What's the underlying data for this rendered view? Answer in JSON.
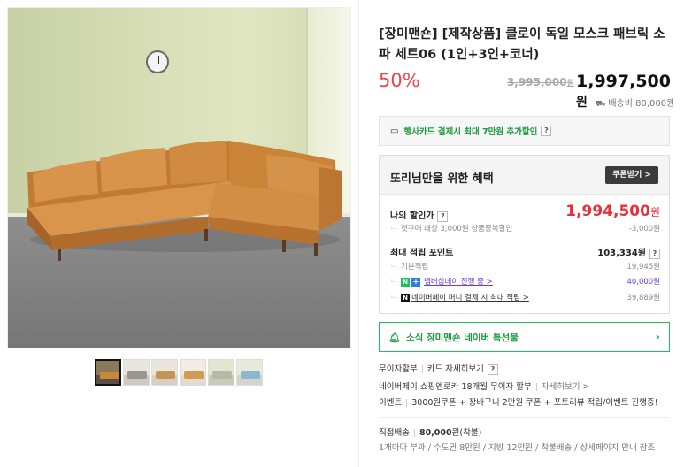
{
  "product": {
    "title": "[장미맨숀] [제작상품] 클로이 독일 모스크 패브릭 소파 세트06 (1인+3인+코너)",
    "discount_rate": "50%",
    "original_price": "3,995,000",
    "original_price_unit": "원",
    "price": "1,997,500",
    "price_unit": "원",
    "shipping": "배송비 80,000원"
  },
  "card_promo": {
    "text": "행사카드 결제시 최대 7만원 추가할인",
    "help": "?"
  },
  "benefit": {
    "title": "또리님만을 위한 혜택",
    "coupon_button": "쿠폰받기 >",
    "my_discount_label": "나의 할인가",
    "my_discount_price": "1,994,500",
    "my_discount_unit": "원",
    "first_purchase_label": "첫구매 대상 3,000원 상품중복할인",
    "first_purchase_value": "-3,000원",
    "points_label": "최대 적립 포인트",
    "points_value": "103,334원",
    "basic_points_label": "기본적립",
    "basic_points_value": "19,945원",
    "membership_label": "멤버십데이 진행 중 >",
    "membership_value": "40,000원",
    "naverpay_label": "네이버페이 머니 결제 시 최대 적립 >",
    "naverpay_value": "39,889원"
  },
  "news": {
    "text": "소식 ⁣장미맨숀 네이버 특선물",
    "chevron": "›"
  },
  "info": {
    "installment_label": "무이자할부",
    "card_detail_link": "카드 자세히보기",
    "help": "?",
    "naverpay_installment": "네이버페이 쇼핑엔로카 18개월 무이자 할부",
    "detail_link": "자세히보기 >",
    "event_label": "이벤트",
    "event_text": "3000원쿠폰 + 장바구니 2만원 쿠폰 + 포토리뷰 적립/이벤트 진행중!",
    "direct_delivery_label": "직접배송",
    "direct_delivery_price": "80,000",
    "direct_delivery_suffix": "원(착불)",
    "delivery_note": "1개마다 부과 / 수도권 8만원 / 지방 12만원 / 착불배송 / 상세페이지 안내 참조"
  },
  "thumbnails": [
    {
      "wall": "#8a7a5a",
      "floor": "#5a5048",
      "sofa": "#c9873c"
    },
    {
      "wall": "#e8e6df",
      "floor": "#cfcac0",
      "sofa": "#9a9590"
    },
    {
      "wall": "#ebe6dc",
      "floor": "#d7cfc2",
      "sofa": "#c49558"
    },
    {
      "wall": "#f1ede4",
      "floor": "#e2dcd0",
      "sofa": "#d39a52"
    },
    {
      "wall": "#dfe7cf",
      "floor": "#c8cdb9",
      "sofa": "#b7b9a6"
    },
    {
      "wall": "#e6ebdc",
      "floor": "#d3d7cb",
      "sofa": "#8fb5d3"
    }
  ],
  "colors": {
    "accent_red": "#f0444a",
    "naver_green": "#19c35a",
    "sofa": "#d18d44"
  }
}
